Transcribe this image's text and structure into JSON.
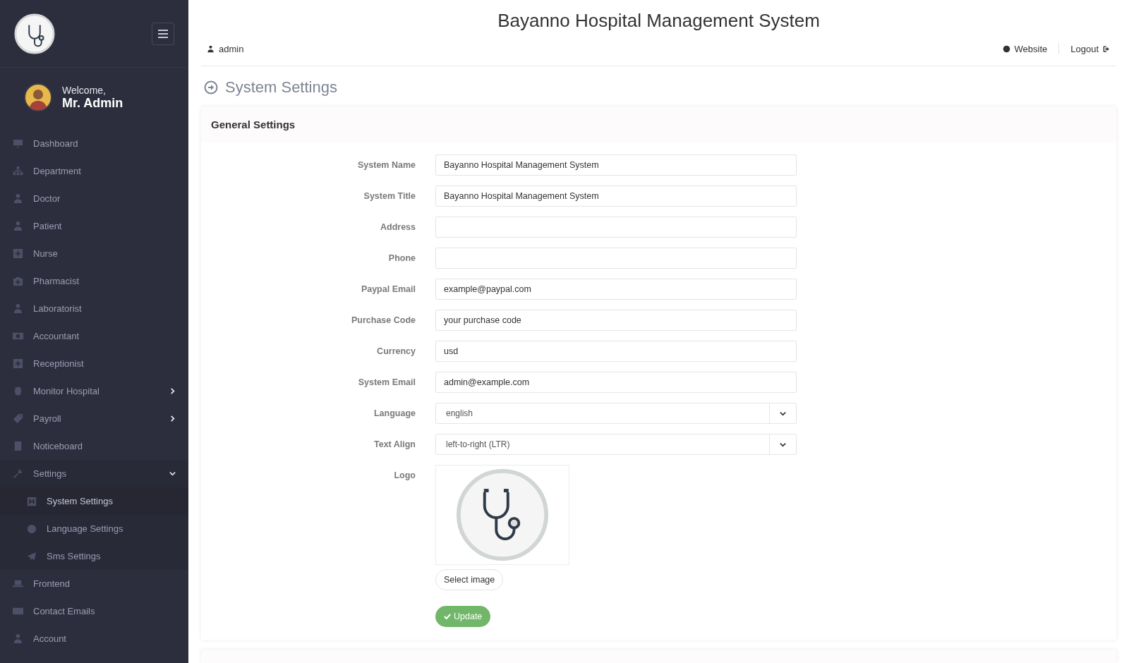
{
  "sidebar": {
    "welcome": "Welcome,",
    "user": "Mr. Admin",
    "items": [
      {
        "label": "Dashboard",
        "kind": "link",
        "selected": false
      },
      {
        "label": "Department",
        "kind": "link",
        "selected": false
      },
      {
        "label": "Doctor",
        "kind": "link",
        "selected": false
      },
      {
        "label": "Patient",
        "kind": "link",
        "selected": false
      },
      {
        "label": "Nurse",
        "kind": "link",
        "selected": false
      },
      {
        "label": "Pharmacist",
        "kind": "link",
        "selected": false
      },
      {
        "label": "Laboratorist",
        "kind": "link",
        "selected": false
      },
      {
        "label": "Accountant",
        "kind": "link",
        "selected": false
      },
      {
        "label": "Receptionist",
        "kind": "link",
        "selected": false
      },
      {
        "label": "Monitor Hospital",
        "kind": "submenu",
        "expanded": false,
        "selected": false
      },
      {
        "label": "Payroll",
        "kind": "submenu",
        "expanded": false,
        "selected": false
      },
      {
        "label": "Noticeboard",
        "kind": "link",
        "selected": false
      },
      {
        "label": "Settings",
        "kind": "submenu",
        "expanded": true,
        "selected": false,
        "children": [
          {
            "label": "System Settings",
            "selected": true
          },
          {
            "label": "Language Settings",
            "selected": false
          },
          {
            "label": "Sms Settings",
            "selected": false
          }
        ]
      },
      {
        "label": "Frontend",
        "kind": "link",
        "selected": false
      },
      {
        "label": "Contact Emails",
        "kind": "link",
        "selected": false
      },
      {
        "label": "Account",
        "kind": "link",
        "selected": false
      }
    ]
  },
  "header": {
    "title": "Bayanno Hospital Management System",
    "user": "admin",
    "links": [
      "Website",
      "Logout"
    ]
  },
  "page_title": "System Settings",
  "panel": {
    "title": "General Settings",
    "fields": [
      {
        "label": "System Name",
        "kind": "text",
        "value": "Bayanno Hospital Management System"
      },
      {
        "label": "System Title",
        "kind": "text",
        "value": "Bayanno Hospital Management System"
      },
      {
        "label": "Address",
        "kind": "text"
      },
      {
        "label": "Phone",
        "kind": "text"
      },
      {
        "label": "Paypal Email",
        "kind": "text",
        "value": "example@paypal.com"
      },
      {
        "label": "Purchase Code",
        "kind": "text",
        "value": "your purchase code"
      },
      {
        "label": "Currency",
        "kind": "text",
        "value": "usd"
      },
      {
        "label": "System Email",
        "kind": "text",
        "value": "admin@example.com"
      },
      {
        "label": "Language",
        "kind": "select",
        "value": "english"
      },
      {
        "label": "Text Align",
        "kind": "select",
        "value": "left-to-right (LTR)"
      },
      {
        "label": "Logo",
        "kind": "image",
        "button": "Select image"
      }
    ],
    "submit": "Update"
  }
}
